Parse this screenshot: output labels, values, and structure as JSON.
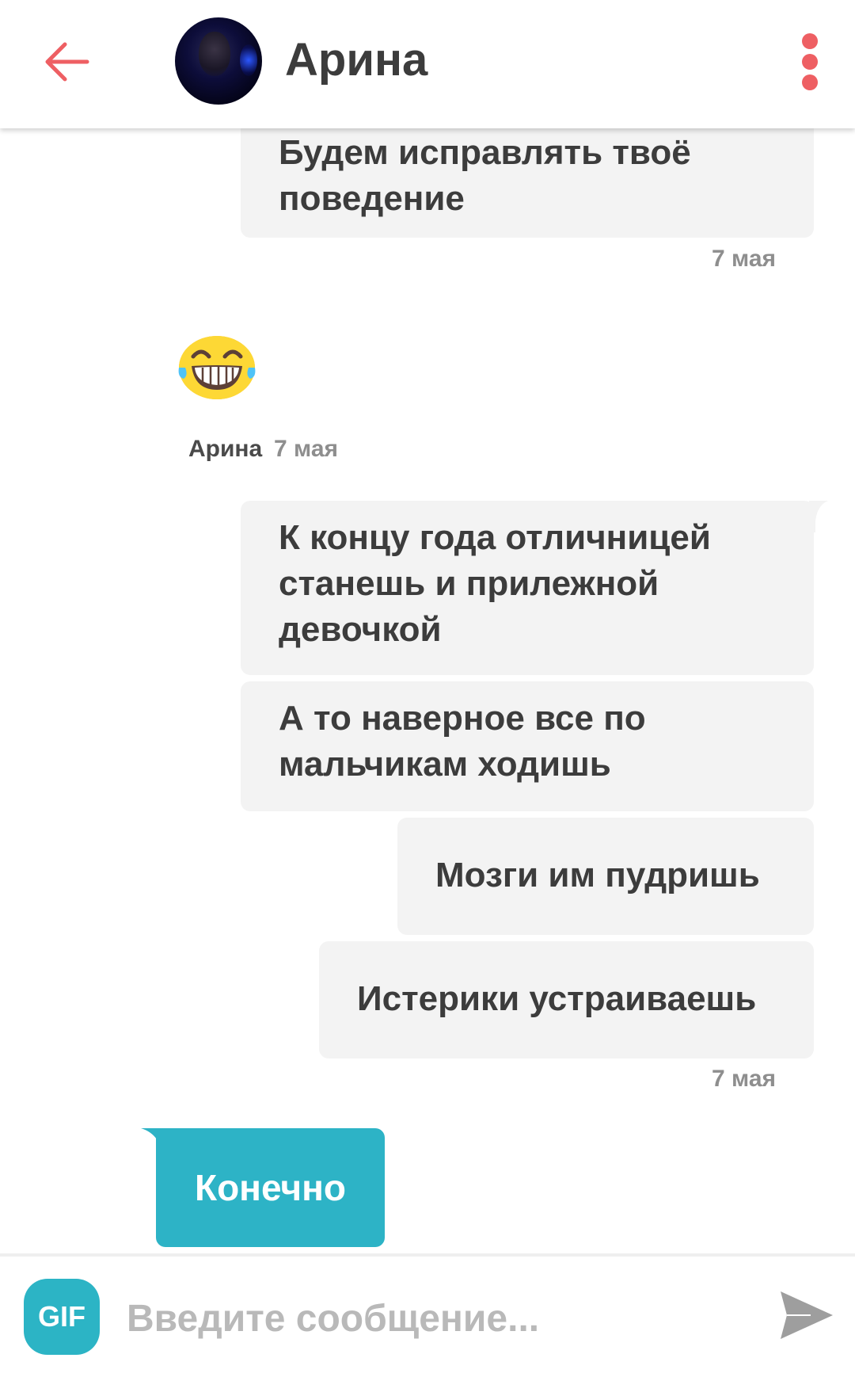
{
  "header": {
    "back_icon": "arrow-left-icon",
    "contact_name": "Арина",
    "menu_icon": "more-vertical-icon",
    "accent_color": "#ee5f63"
  },
  "messages": {
    "incoming_block_1": {
      "text": "Будем исправлять твоё\nповедение",
      "timestamp": "7 мая"
    },
    "emoji_message": {
      "emoji": "laughing-tears-emoji",
      "sender": "Арина",
      "timestamp": "7 мая"
    },
    "incoming_block_2": {
      "items": [
        "К концу года отличницей\nстанешь и прилежной\nдевочкой",
        "А то наверное все по\nмальчикам ходишь",
        "Мозги им пудришь",
        "Истерики устраиваешь"
      ],
      "timestamp": "7 мая"
    },
    "outgoing": {
      "text": "Конечно",
      "color": "#2db3c6"
    }
  },
  "input_bar": {
    "gif_label": "GIF",
    "placeholder": "Введите сообщение...",
    "send_icon": "send-icon"
  }
}
